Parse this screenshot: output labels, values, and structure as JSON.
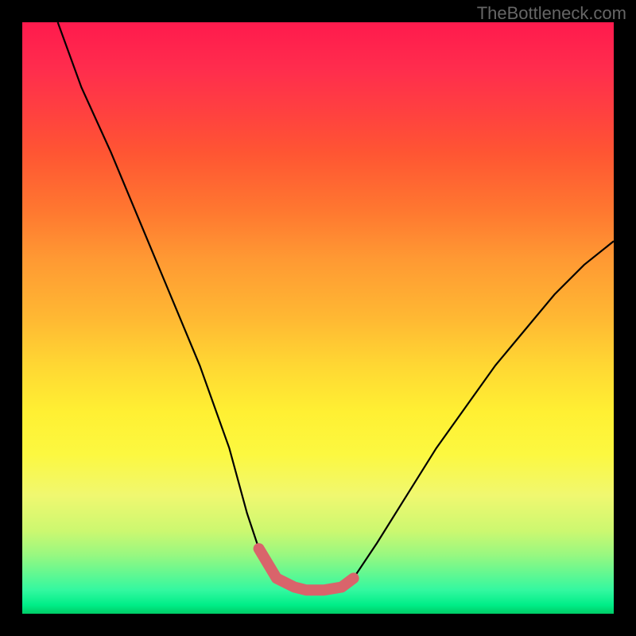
{
  "watermark": "TheBottleneck.com",
  "chart_data": {
    "type": "line",
    "title": "",
    "xlabel": "",
    "ylabel": "",
    "xlim": [
      0,
      100
    ],
    "ylim": [
      0,
      100
    ],
    "series": [
      {
        "name": "bottleneck-curve",
        "x": [
          6,
          10,
          15,
          20,
          25,
          30,
          35,
          38,
          40,
          43,
          48,
          51,
          54,
          56,
          60,
          65,
          70,
          75,
          80,
          85,
          90,
          95,
          100
        ],
        "y": [
          100,
          89,
          78,
          66,
          54,
          42,
          28,
          17,
          11,
          6,
          4,
          4,
          4,
          6,
          12,
          20,
          28,
          35,
          42,
          48,
          54,
          59,
          63
        ]
      }
    ],
    "annotations": [
      {
        "name": "bottom-highlight",
        "color": "#d9646b",
        "x": [
          40,
          43,
          46,
          48,
          51,
          54,
          56
        ],
        "y": [
          11,
          6,
          4.5,
          4,
          4,
          4.5,
          6
        ]
      }
    ],
    "gradient_stops": [
      {
        "pos": 0,
        "color": "#ff1a4d"
      },
      {
        "pos": 50,
        "color": "#ffd733"
      },
      {
        "pos": 100,
        "color": "#00cc66"
      }
    ]
  }
}
